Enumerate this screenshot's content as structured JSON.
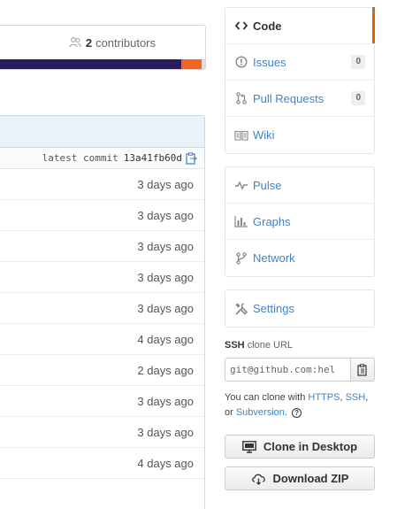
{
  "contributors": {
    "count": "2",
    "label": "contributors",
    "icon": "contributors-icon"
  },
  "language_bar": [
    {
      "name": "primary-language",
      "fraction": 0.885,
      "color": "#2a1b63"
    },
    {
      "name": "secondary-language",
      "fraction": 0.1,
      "color": "#f26522"
    },
    {
      "name": "other-language",
      "fraction": 0.015,
      "color": "#dddddd"
    }
  ],
  "file_list": {
    "latest_commit_label": "latest commit",
    "latest_commit_sha": "13a41fb60d",
    "ages": [
      "3 days ago",
      "3 days ago",
      "3 days ago",
      "3 days ago",
      "3 days ago",
      "4 days ago",
      "2 days ago",
      "3 days ago",
      "3 days ago",
      "4 days ago"
    ]
  },
  "nav": {
    "primary": [
      {
        "name": "code",
        "label": "Code",
        "icon": "code-icon",
        "selected": true
      },
      {
        "name": "issues",
        "label": "Issues",
        "icon": "issues-icon",
        "count": "0"
      },
      {
        "name": "pull-requests",
        "label": "Pull Requests",
        "icon": "pull-request-icon",
        "count": "0"
      },
      {
        "name": "wiki",
        "label": "Wiki",
        "icon": "wiki-icon"
      }
    ],
    "secondary": [
      {
        "name": "pulse",
        "label": "Pulse",
        "icon": "pulse-icon"
      },
      {
        "name": "graphs",
        "label": "Graphs",
        "icon": "graphs-icon"
      },
      {
        "name": "network",
        "label": "Network",
        "icon": "network-icon"
      }
    ],
    "tertiary": [
      {
        "name": "settings",
        "label": "Settings",
        "icon": "settings-icon"
      }
    ]
  },
  "clone": {
    "protocol": "SSH",
    "title_suffix": "clone URL",
    "url": "git@github.com:hel",
    "help_prefix": "You can clone with",
    "https": "HTTPS",
    "ssh": "SSH",
    "or": "or",
    "subversion": "Subversion",
    "help_q": "?",
    "desktop_button": "Clone in Desktop",
    "zip_button": "Download ZIP"
  }
}
